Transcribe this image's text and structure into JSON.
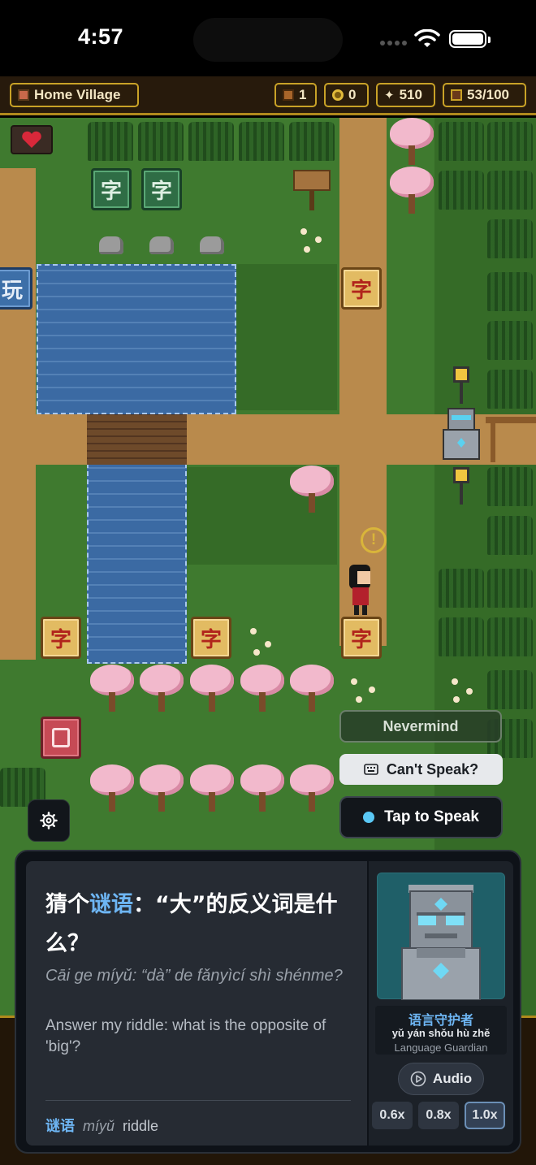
{
  "status_bar": {
    "time": "4:57"
  },
  "hud": {
    "location": "Home Village",
    "chests": "1",
    "coins": "0",
    "sparkles": "510",
    "collection": "53/100"
  },
  "map": {
    "tiles": {
      "green_char": "字",
      "gold_char": "字",
      "blue_char": "玩",
      "red_char": "🀄"
    },
    "alert_symbol": "!"
  },
  "speech_controls": {
    "nevermind": "Nevermind",
    "cant_speak": "Can't Speak?",
    "tap_to_speak": "Tap to Speak"
  },
  "dialog": {
    "riddle_zh_prefix": "猜个",
    "riddle_zh_highlight": "谜语",
    "riddle_zh_rest": "：“大”的反义词是什么？",
    "riddle_pinyin": "Cāi ge míyǔ: “dà” de fǎnyìcí shì shénme?",
    "riddle_en": "Answer my riddle: what is the opposite of 'big'?",
    "vocab": {
      "word": "谜语",
      "pinyin": "míyǔ",
      "meaning": "riddle"
    },
    "npc": {
      "name_zh": "语言守护者",
      "name_pinyin": "yǔ yán shǒu hù zhě",
      "name_en": "Language Guardian"
    },
    "audio_label": "Audio",
    "speeds": [
      "0.6x",
      "0.8x",
      "1.0x"
    ],
    "active_speed": "1.0x"
  },
  "colors": {
    "accent_blue": "#6eb6f4",
    "hud_gold": "#c9a227",
    "grass": "#3f7a2f",
    "water": "#3b6aa3",
    "path": "#b98a4c",
    "blossom": "#f2b9cc"
  },
  "icons": {
    "hud_location": "map-flag-icon",
    "hud_chests": "chest-icon",
    "hud_coins": "coin-icon",
    "hud_sparkles": "sparkle-icon",
    "hud_collection": "book-icon",
    "heart": "heart-icon",
    "settings": "gear-icon",
    "keyboard": "keyboard-icon",
    "audio": "play-circle-icon"
  }
}
